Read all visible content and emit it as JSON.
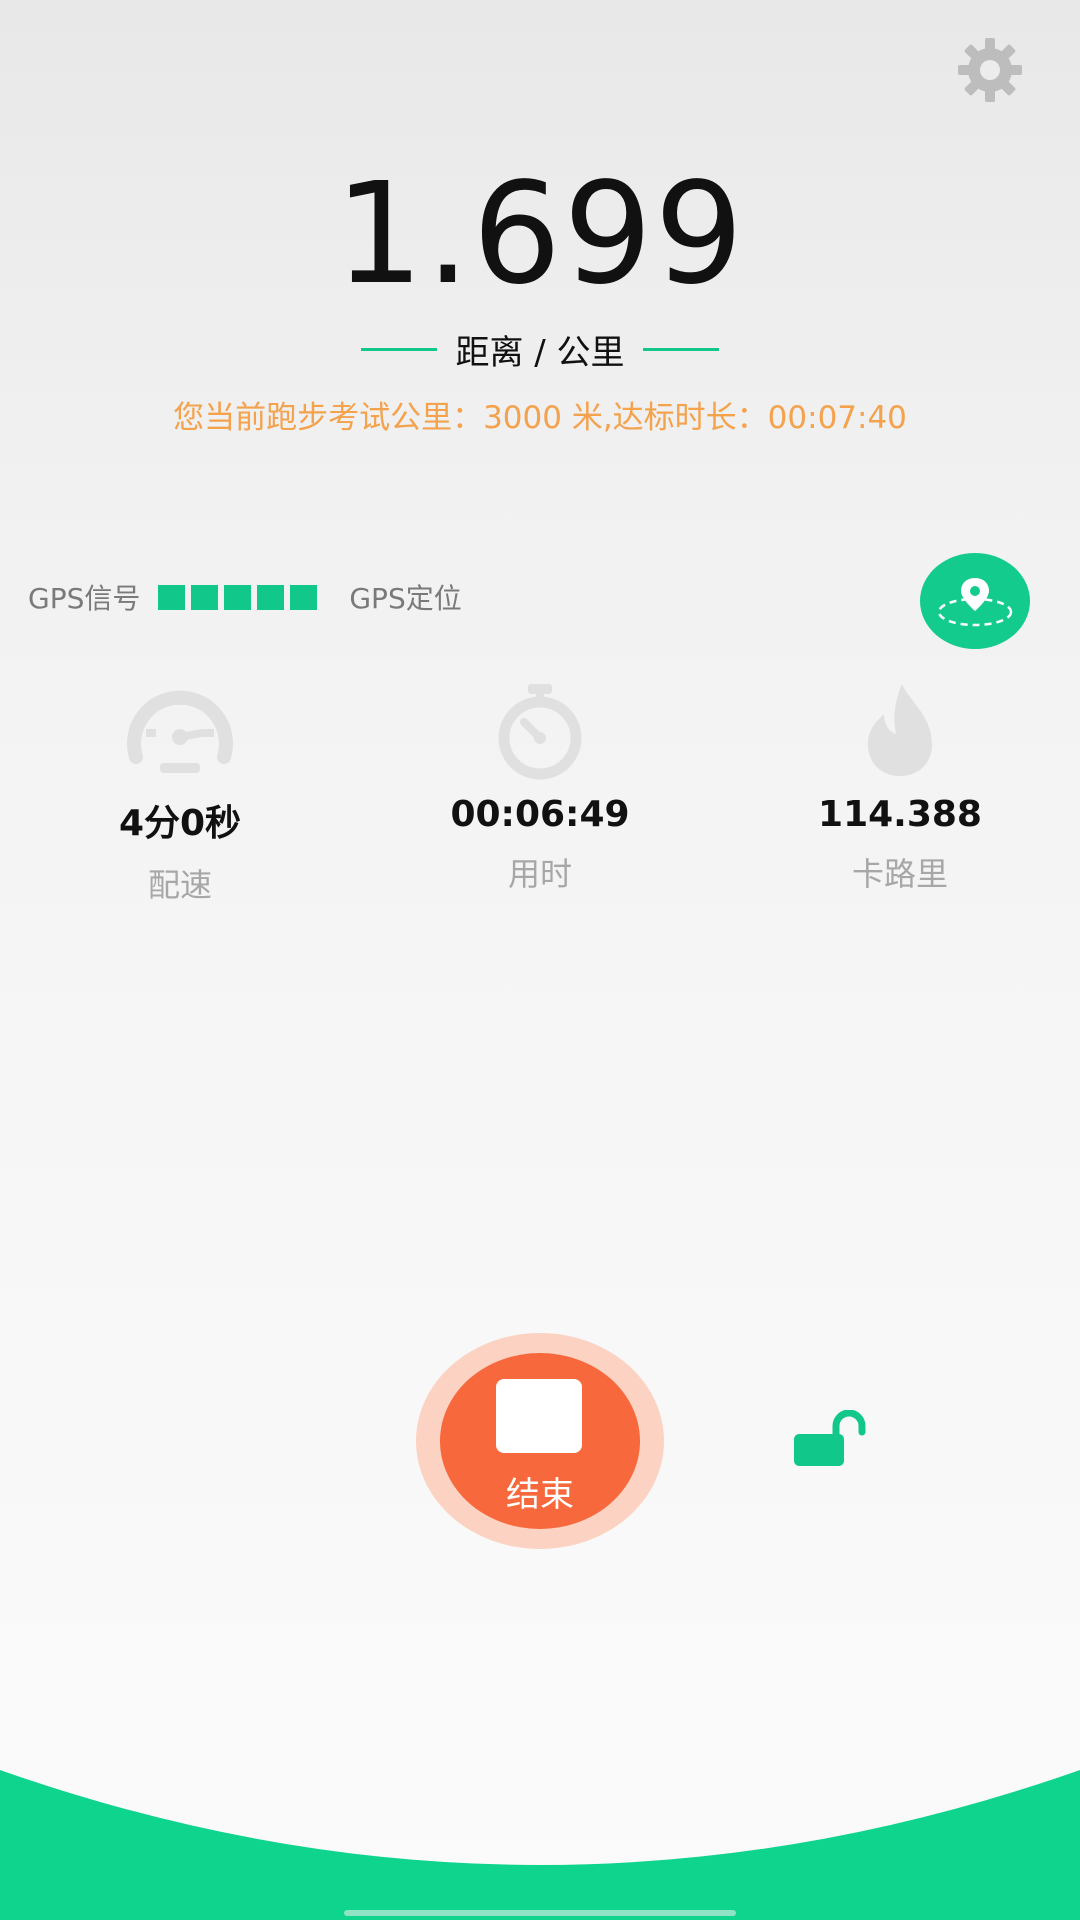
{
  "distance": {
    "value": "1.699",
    "label": "距离 / 公里"
  },
  "exam_info": "您当前跑步考试公里：3000 米,达标时长：00:07:40",
  "gps": {
    "signal_label": "GPS信号",
    "bars": 5,
    "locate_label": "GPS定位"
  },
  "stats": {
    "pace": {
      "value": "4分0秒",
      "label": "配速",
      "icon": "speedometer-icon"
    },
    "time": {
      "value": "00:06:49",
      "label": "用时",
      "icon": "stopwatch-icon"
    },
    "calories": {
      "value": "114.388",
      "label": "卡路里",
      "icon": "flame-icon"
    }
  },
  "controls": {
    "stop_label": "结束"
  },
  "colors": {
    "accent_green": "#11c88a",
    "orange": "#f7683c",
    "exam_text": "#f4a24c"
  }
}
